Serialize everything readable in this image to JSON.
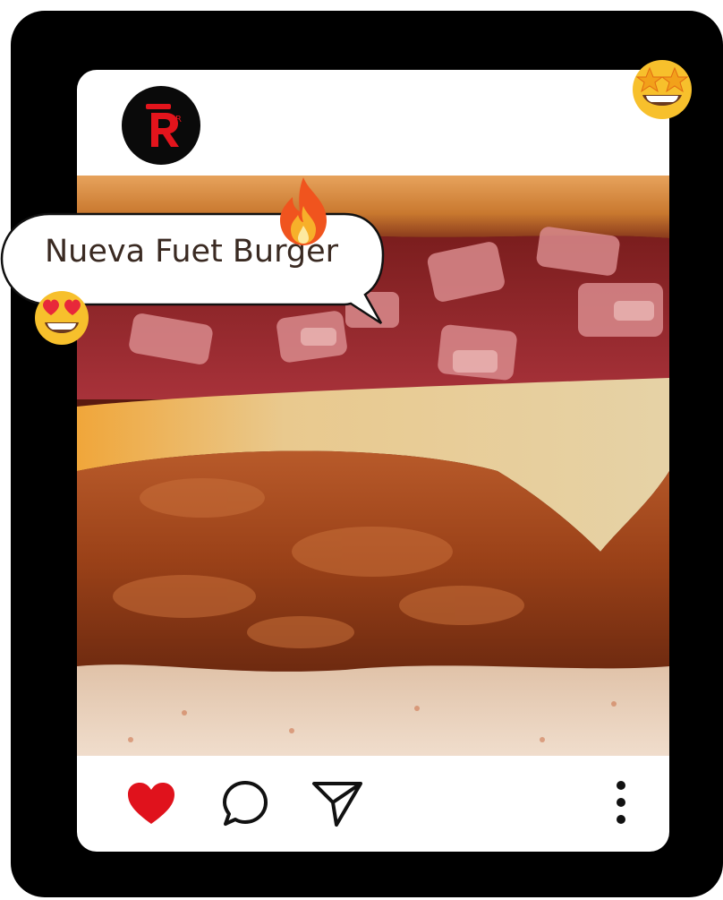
{
  "post": {
    "caption": "Nueva Fuet Burger",
    "brand_logo_letter": "R"
  },
  "actions": {
    "like_icon": "heart-icon",
    "comment_icon": "comment-icon",
    "share_icon": "paper-plane-icon",
    "more_icon": "more-vertical-icon"
  },
  "emojis": [
    "star-struck-emoji",
    "fire-emoji",
    "heart-eyes-emoji"
  ],
  "colors": {
    "frame": "#000000",
    "card": "#ffffff",
    "like": "#e0121c",
    "logo_red": "#e3141c",
    "text": "#3a2a22"
  }
}
